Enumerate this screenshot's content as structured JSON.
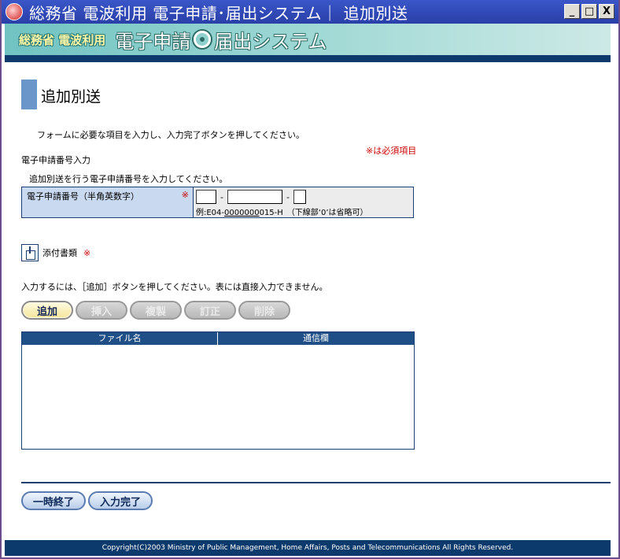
{
  "window": {
    "title": "総務省 電波利用 電子申請･届出システム｜ 追加別送",
    "minimize_label": "_",
    "maximize_label": "□",
    "close_label": "X"
  },
  "banner": {
    "logo_left": "総務省 電波利用",
    "logo_main_a": "電子申請",
    "logo_main_b": "届出システム"
  },
  "page": {
    "title": "追加別送",
    "instruction": "フォームに必要な項目を入力し、入力完了ボタンを押してください。",
    "required_note": "※は必須項目"
  },
  "section": {
    "label": "電子申請番号入力",
    "description": "追加別送を行う電子申請番号を入力してください。"
  },
  "app_number": {
    "label": "電子申請番号（半角英数字）",
    "required_mark": "※",
    "part1_value": "",
    "part2_value": "",
    "part3_value": "",
    "separator": "-",
    "example_prefix": "例:E04-",
    "example_underlined": "0000000",
    "example_suffix": "015-H　（下線部‘0’は省略可）"
  },
  "attachments": {
    "label": "添付書類",
    "required_mark": "※",
    "table_instruction": "入力するには、［追加］ボタンを押してください。表には直接入力できません。",
    "buttons": {
      "add": "追加",
      "insert": "挿入",
      "duplicate": "複製",
      "edit": "訂正",
      "delete": "削除"
    },
    "columns": {
      "filename": "ファイル名",
      "comment": "通信欄"
    }
  },
  "bottom": {
    "temp_end": "一時終了",
    "complete": "入力完了"
  },
  "footer": {
    "copyright": "Copyright(C)2003 Ministry of Public Management, Home Affairs, Posts and Telecommunications All Rights Reserved."
  }
}
